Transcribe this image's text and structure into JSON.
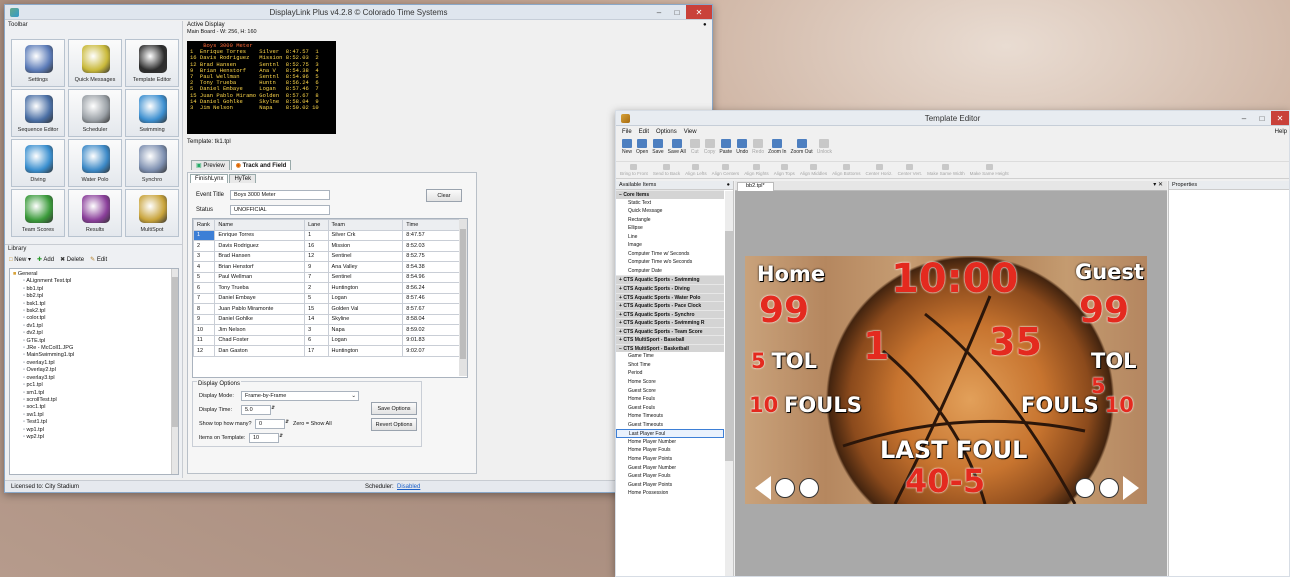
{
  "displaylink": {
    "title": "DisplayLink Plus v4.2.8 © Colorado Time Systems",
    "toolbar_label": "Toolbar",
    "buttons": [
      {
        "label": "Settings",
        "icon": "gears-icon"
      },
      {
        "label": "Quick Messages",
        "icon": "message-note-icon"
      },
      {
        "label": "Template Editor",
        "icon": "pen-notebook-icon"
      },
      {
        "label": "Sequence Editor",
        "icon": "film-pencil-icon"
      },
      {
        "label": "Scheduler",
        "icon": "clock-icon"
      },
      {
        "label": "Swimming",
        "icon": "swimmer-icon"
      },
      {
        "label": "Diving",
        "icon": "diver-icon"
      },
      {
        "label": "Water Polo",
        "icon": "water-polo-icon"
      },
      {
        "label": "Synchro",
        "icon": "synchro-icon"
      },
      {
        "label": "Team Scores",
        "icon": "stars-icon"
      },
      {
        "label": "Results",
        "icon": "medals-icon"
      },
      {
        "label": "MultiSpot",
        "icon": "balls-icon"
      }
    ],
    "active_display_label": "Active Display",
    "main_board_label": "Main Board - W: 256, H: 160",
    "board_lines": [
      "    Boys 3000 Meter",
      "1  Enrique Torres    Silver  8:47.57  1",
      "16 Davis Rodriguez   Mission 8:52.03  2",
      "12 Brad Hansen       Sentnl  8:52.75  3",
      "9  Brian Henstorf    Ana V   8:54.38  4",
      "7  Paul Wellman      Sentnl  8:54.96  5",
      "2  Tony Trueba       Huntn   8:56.24  6",
      "5  Daniel Embaye     Logan   8:57.46  7",
      "15 Juan Pablo Miramo Golden  8:57.67  8",
      "14 Daniel Gohlke     Skylne  8:58.04  9",
      "3  Jim Nelson        Napa    8:59.02 10"
    ],
    "template_label": "Template: tk1.tpl",
    "tabs": [
      "Preview",
      "Track and Field"
    ],
    "subtabs": [
      "FinishLynx",
      "HyTek"
    ],
    "event_title_label": "Event Title",
    "event_title_value": "Boys 3000 Meter",
    "status_label": "Status",
    "status_value": "UNOFFICIAL",
    "clear_label": "Clear",
    "columns": [
      "Rank",
      "Name",
      "Lane",
      "Team",
      "Time"
    ],
    "rows": [
      [
        "1",
        "Enrique Torres",
        "1",
        "Silver Crk",
        "8:47.57"
      ],
      [
        "2",
        "Davis Rodriguez",
        "16",
        "Mission",
        "8:52.03"
      ],
      [
        "3",
        "Brad Hansen",
        "12",
        "Sentinel",
        "8:52.75"
      ],
      [
        "4",
        "Brian Henstorf",
        "9",
        "Ana Valley",
        "8:54.38"
      ],
      [
        "5",
        "Paul Wellman",
        "7",
        "Sentinel",
        "8:54.96"
      ],
      [
        "6",
        "Tony Trueba",
        "2",
        "Huntington",
        "8:56.24"
      ],
      [
        "7",
        "Daniel Embaye",
        "5",
        "Logan",
        "8:57.46"
      ],
      [
        "8",
        "Juan Pablo Miramonte",
        "15",
        "Golden Val",
        "8:57.67"
      ],
      [
        "9",
        "Daniel Gohlke",
        "14",
        "Skyline",
        "8:58.04"
      ],
      [
        "10",
        "Jim Nelson",
        "3",
        "Napa",
        "8:59.02"
      ],
      [
        "11",
        "Chad Foster",
        "6",
        "Logan",
        "9:01.83"
      ],
      [
        "12",
        "Dan Gaston",
        "17",
        "Huntington",
        "9:02.07"
      ]
    ],
    "display_options_label": "Display Options",
    "display_mode_label": "Display Mode:",
    "display_mode_value": "Frame-by-Frame",
    "display_time_label": "Display Time:",
    "display_time_value": "5.0",
    "show_top_label": "Show top how many?",
    "show_top_value": "0",
    "zero_note": "Zero = Show All",
    "items_label": "Items on Template:",
    "items_value": "10",
    "save_options": "Save Options",
    "revert_options": "Revert Options",
    "library_label": "Library",
    "lib_new": "New",
    "lib_add": "Add",
    "lib_delete": "Delete",
    "lib_edit": "Edit",
    "library_files": [
      "General",
      "ALignment Test.tpl",
      "bb1.tpl",
      "bb2.tpl",
      "bsk1.tpl",
      "bsk2.tpl",
      "color.tpl",
      "dv1.tpl",
      "dv2.tpl",
      "GTE.tpl",
      "JRe - McColl1.JPG",
      "MainSwimming1.tpl",
      "overlay1.tpl",
      "Overlay2.tpl",
      "overlay3.tpl",
      "pc1.tpl",
      "sm1.tpl",
      "scrollTest.tpl",
      "soc1.tpl",
      "sw1.tpl",
      "Test1.tpl",
      "wp1.tpl",
      "wp2.tpl"
    ],
    "licensed": "Licensed to: City Stadium",
    "scheduler_label": "Scheduler:",
    "scheduler_value": "Disabled"
  },
  "template_editor": {
    "title": "Template Editor",
    "menu": [
      "File",
      "Edit",
      "Options",
      "View"
    ],
    "help": "Help",
    "tools_row1": [
      {
        "label": "New",
        "enabled": true
      },
      {
        "label": "Open",
        "enabled": true
      },
      {
        "label": "Save",
        "enabled": true
      },
      {
        "label": "Save All",
        "enabled": true
      },
      {
        "label": "Cut",
        "enabled": false
      },
      {
        "label": "Copy",
        "enabled": false
      },
      {
        "label": "Paste",
        "enabled": true
      },
      {
        "label": "Undo",
        "enabled": true
      },
      {
        "label": "Redo",
        "enabled": false
      },
      {
        "label": "Zoom In",
        "enabled": true
      },
      {
        "label": "Zoom Out",
        "enabled": true
      },
      {
        "label": "Unlock",
        "enabled": false
      }
    ],
    "tools_row2": [
      "Bring to Front",
      "Send to Back",
      "Align Lefts",
      "Align Centers",
      "Align Rights",
      "Align Tops",
      "Align Middles",
      "Align Bottoms",
      "Center Horiz.",
      "Center Vert.",
      "Make Same Width",
      "Make Same Height"
    ],
    "available_items_label": "Available Items",
    "doc_tab": "bb2.tpl*",
    "properties_label": "Properties",
    "items": [
      {
        "t": "g",
        "label": "Core Items"
      },
      {
        "t": "i",
        "label": "Static Text"
      },
      {
        "t": "i",
        "label": "Quick Message"
      },
      {
        "t": "i",
        "label": "Rectangle"
      },
      {
        "t": "i",
        "label": "Ellipse"
      },
      {
        "t": "i",
        "label": "Line"
      },
      {
        "t": "i",
        "label": "Image"
      },
      {
        "t": "i",
        "label": "Computer Time w/ Seconds"
      },
      {
        "t": "i",
        "label": "Computer Time w/o Seconds"
      },
      {
        "t": "i",
        "label": "Computer Date"
      },
      {
        "t": "g",
        "label": "CTS Aquatic Sports - Swimming"
      },
      {
        "t": "g",
        "label": "CTS Aquatic Sports - Diving"
      },
      {
        "t": "g",
        "label": "CTS Aquatic Sports - Water Polo"
      },
      {
        "t": "g",
        "label": "CTS Aquatic Sports - Pace Clock"
      },
      {
        "t": "g",
        "label": "CTS Aquatic Sports - Synchro"
      },
      {
        "t": "g",
        "label": "CTS Aquatic Sports - Swimming R"
      },
      {
        "t": "g",
        "label": "CTS Aquatic Sports - Team Score"
      },
      {
        "t": "g",
        "label": "CTS MultiSport - Baseball"
      },
      {
        "t": "g",
        "label": "CTS MultiSport - Basketball"
      },
      {
        "t": "i",
        "label": "Game Time"
      },
      {
        "t": "i",
        "label": "Shot Time"
      },
      {
        "t": "i",
        "label": "Period"
      },
      {
        "t": "i",
        "label": "Home Score"
      },
      {
        "t": "i",
        "label": "Guest Score"
      },
      {
        "t": "i",
        "label": "Home Fouls"
      },
      {
        "t": "i",
        "label": "Guest Fouls"
      },
      {
        "t": "i",
        "label": "Home Timeouts"
      },
      {
        "t": "i",
        "label": "Guest Timeouts"
      },
      {
        "t": "s",
        "label": "Last Player Foul"
      },
      {
        "t": "i",
        "label": "Home Player Number"
      },
      {
        "t": "i",
        "label": "Home Player Fouls"
      },
      {
        "t": "i",
        "label": "Home Player Points"
      },
      {
        "t": "i",
        "label": "Guest Player Number"
      },
      {
        "t": "i",
        "label": "Guest Player Fouls"
      },
      {
        "t": "i",
        "label": "Guest Player Points"
      },
      {
        "t": "i",
        "label": "Home Possession"
      }
    ],
    "board": {
      "home_label": "Home",
      "guest_label": "Guest",
      "game_time": "10:00",
      "home_score": "99",
      "guest_score": "99",
      "period": "1",
      "shot_clock": "35",
      "tol_label": "TOL",
      "home_tol": "5",
      "guest_tol": "5",
      "home_fouls": "10",
      "guest_fouls": "10",
      "fouls_label": "FOULS",
      "last_foul_label": "LAST FOUL",
      "last_foul_value": "40-5"
    }
  },
  "colors": {
    "accent": "#3d7fd6",
    "score_red": "#e42a1f",
    "close_red": "#c9413a"
  }
}
